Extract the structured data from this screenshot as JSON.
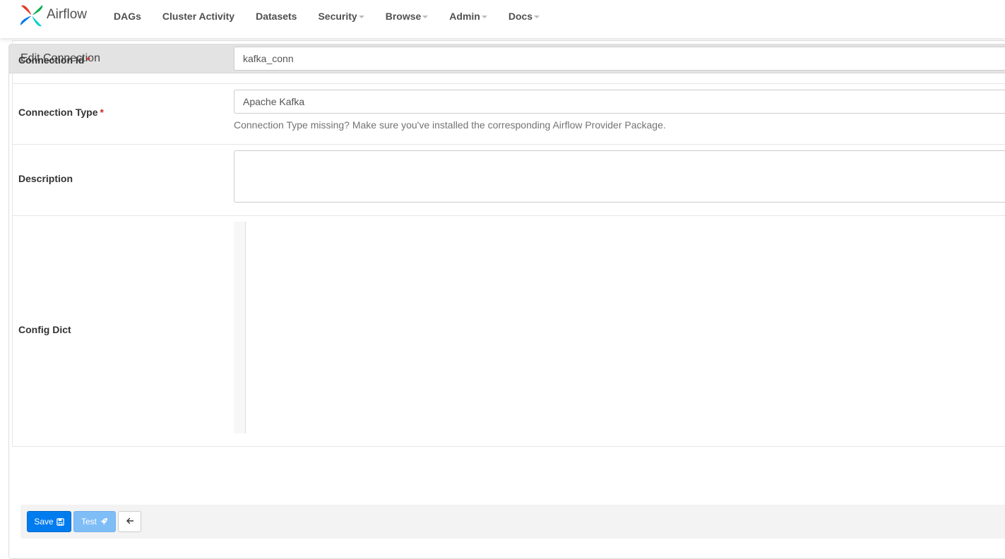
{
  "brand": {
    "name": "Airflow"
  },
  "nav": {
    "items": [
      {
        "label": "DAGs",
        "dropdown": false
      },
      {
        "label": "Cluster Activity",
        "dropdown": false
      },
      {
        "label": "Datasets",
        "dropdown": false
      },
      {
        "label": "Security",
        "dropdown": true
      },
      {
        "label": "Browse",
        "dropdown": true
      },
      {
        "label": "Admin",
        "dropdown": true
      },
      {
        "label": "Docs",
        "dropdown": true
      }
    ]
  },
  "panel": {
    "title": "Edit Connection"
  },
  "form": {
    "connection_id": {
      "label": "Connection Id",
      "required_mark": "*",
      "value": "kafka_conn"
    },
    "connection_type": {
      "label": "Connection Type",
      "required_mark": "*",
      "value": "Apache Kafka",
      "help": "Connection Type missing? Make sure you've installed the corresponding Airflow Provider Package."
    },
    "description": {
      "label": "Description",
      "value": ""
    },
    "config_dict": {
      "label": "Config Dict"
    }
  },
  "footer": {
    "save_label": "Save",
    "test_label": "Test"
  },
  "colors": {
    "primary": "#017cee",
    "primary_disabled": "#7fbdf6",
    "required": "#c9302c",
    "code_string": "#aa1111"
  },
  "icons": {
    "save": "floppy-disk-icon",
    "test": "rocket-icon",
    "back": "arrow-left-icon"
  }
}
